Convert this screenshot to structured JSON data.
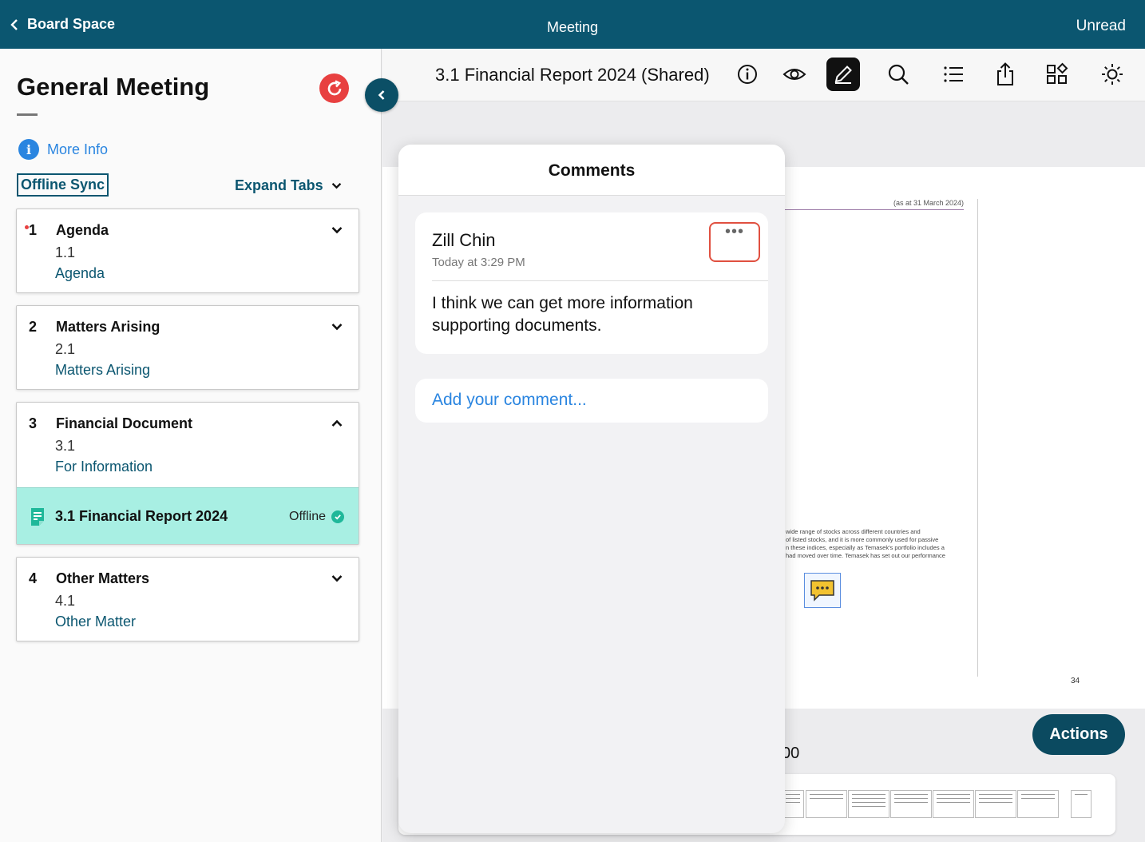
{
  "topbar": {
    "back_label": "Board Space",
    "title": "Meeting",
    "right_label": "Unread"
  },
  "sidebar": {
    "meeting_title": "General Meeting",
    "more_info": "More Info",
    "offline_sync": "Offline Sync",
    "expand_tabs": "Expand Tabs",
    "sections": [
      {
        "number": "1",
        "title": "Agenda",
        "sub_number": "1.1",
        "sub_label": "Agenda"
      },
      {
        "number": "2",
        "title": "Matters Arising",
        "sub_number": "2.1",
        "sub_label": "Matters Arising"
      },
      {
        "number": "3",
        "title": "Financial Document",
        "sub_number": "3.1",
        "sub_label": "For Information",
        "document": {
          "title": "3.1 Financial Report 2024",
          "status": "Offline"
        }
      },
      {
        "number": "4",
        "title": "Other Matters",
        "sub_number": "4.1",
        "sub_label": "Other Matter"
      }
    ]
  },
  "document": {
    "title": "3.1 Financial Report 2024 (Shared)",
    "toolbar_icons": [
      "info-icon",
      "eye-icon",
      "pen-icon",
      "search-icon",
      "list-icon",
      "share-icon",
      "apps-icon",
      "brightness-icon"
    ],
    "page": {
      "date_note": "(as at 31 March 2024)",
      "body_lines": [
        "wide range of stocks across different countries and",
        "of listed stocks, and it is more commonly used for passive",
        "n these indices, especially as Temasek's portfolio includes a",
        "had moved over time. Temasek has set out our performance"
      ],
      "page_number": "34"
    },
    "page_indicator": "00",
    "actions_label": "Actions"
  },
  "comments": {
    "title": "Comments",
    "items": [
      {
        "author": "Zill Chin",
        "time": "Today at 3:29 PM",
        "menu": "•••",
        "body": "I think we can get more information supporting documents."
      }
    ],
    "add_placeholder": "Add your comment..."
  },
  "colors": {
    "primary": "#0b5670",
    "accent": "#2a85e0",
    "selected_row": "#a8efe3",
    "alert": "#e84040"
  }
}
